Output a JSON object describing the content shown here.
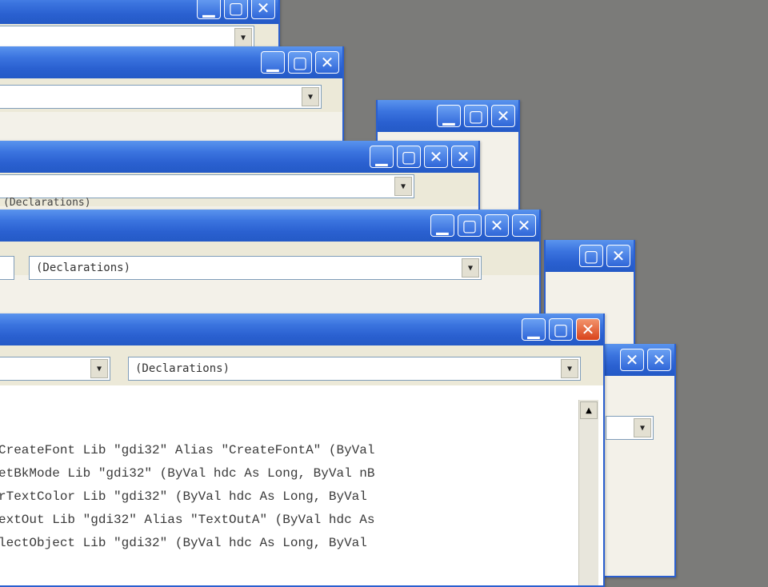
{
  "icons": {
    "minimize": "▁",
    "maximize": "▢",
    "close": "✕",
    "dropdown": "▼",
    "scroll_up": "▲"
  },
  "colors": {
    "desktop": "#7b7b79",
    "titlebar": "#2a60d0",
    "close_active": "#d9431b"
  },
  "windows": [
    {
      "procedure_value": ""
    },
    {
      "procedure_value": ""
    },
    {
      "procedure_value": ""
    },
    {
      "procedure_value": "(Declarations)"
    },
    {
      "procedure_value": "(Declarations)"
    },
    {
      "procedure_value": "(Declarations)"
    }
  ],
  "fragment_label": "(Declarations)",
  "code_lines": [
    "CreateFont Lib \"gdi32\" Alias \"CreateFontA\" (ByVal",
    "etBkMode Lib \"gdi32\" (ByVal hdc As Long, ByVal nB",
    "rTextColor Lib \"gdi32\" (ByVal hdc As Long, ByVal",
    "extOut Lib \"gdi32\" Alias \"TextOutA\" (ByVal hdc As",
    "lectObject Lib \"gdi32\" (ByVal hdc As Long, ByVal"
  ]
}
